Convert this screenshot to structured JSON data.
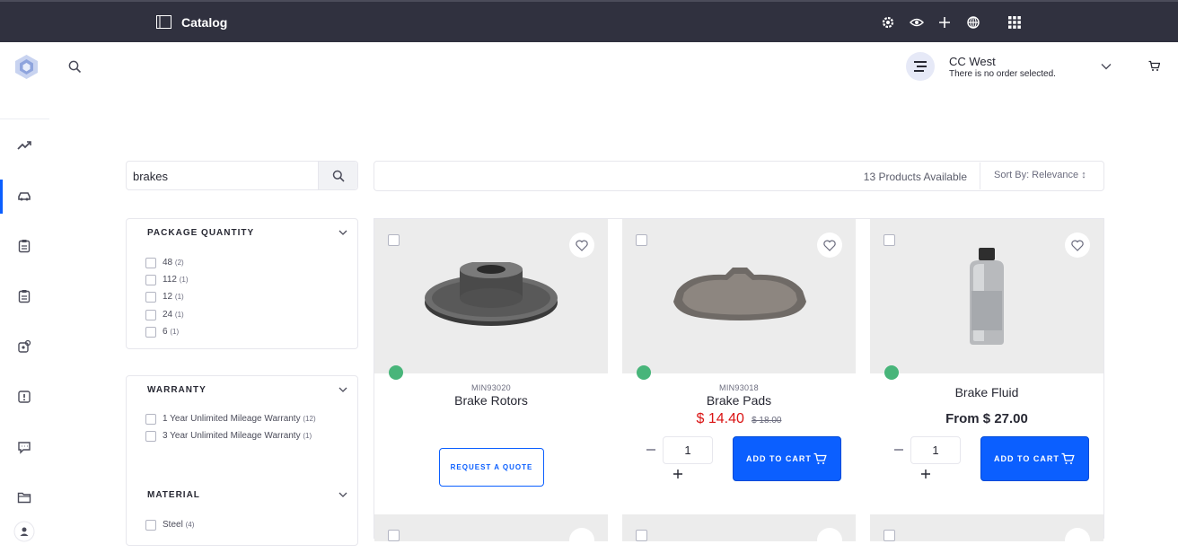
{
  "topbar": {
    "title": "Catalog"
  },
  "account": {
    "name": "CC West",
    "subtitle": "There is no order selected."
  },
  "search": {
    "value": "brakes"
  },
  "results": {
    "count_text": "13 Products Available",
    "sort_label": "Sort By: Relevance ↕"
  },
  "facets": {
    "package_quantity": {
      "title": "PACKAGE QUANTITY",
      "options": [
        {
          "label": "48",
          "count": "(2)"
        },
        {
          "label": "112",
          "count": "(1)"
        },
        {
          "label": "12",
          "count": "(1)"
        },
        {
          "label": "24",
          "count": "(1)"
        },
        {
          "label": "6",
          "count": "(1)"
        }
      ]
    },
    "warranty": {
      "title": "WARRANTY",
      "options": [
        {
          "label": "1 Year Unlimited Mileage Warranty",
          "count": "(12)"
        },
        {
          "label": "3 Year Unlimited Mileage Warranty",
          "count": "(1)"
        }
      ]
    },
    "material": {
      "title": "MATERIAL",
      "options": [
        {
          "label": "Steel",
          "count": "(4)"
        }
      ]
    }
  },
  "products": [
    {
      "sku": "MIN93020",
      "name": "Brake Rotors",
      "action_label": "REQUEST A QUOTE"
    },
    {
      "sku": "MIN93018",
      "name": "Brake Pads",
      "price": "$ 14.40",
      "old_price": "$ 18.00",
      "qty": "1",
      "action_label": "ADD TO CART"
    },
    {
      "name": "Brake Fluid",
      "price": "From $ 27.00",
      "qty": "1",
      "action_label": "ADD TO CART"
    }
  ],
  "colors": {
    "topbar": "#30313f",
    "accent": "#0b5fff",
    "sale_price": "#da1414",
    "status_dot": "#48b57a"
  }
}
